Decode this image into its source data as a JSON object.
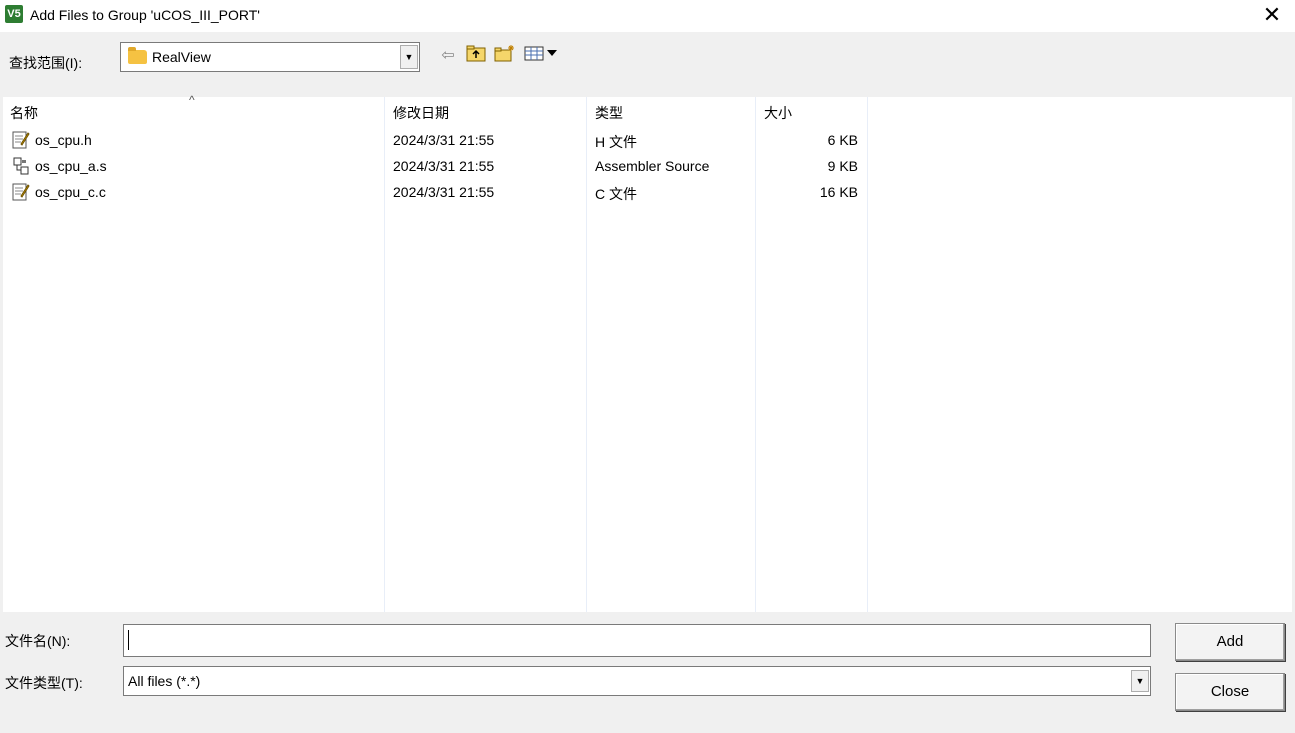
{
  "window": {
    "title": "Add Files to Group 'uCOS_III_PORT'",
    "app_icon_text": "V5"
  },
  "lookin": {
    "label": "查找范围(I):",
    "value": "RealView"
  },
  "toolbar": {
    "icons": [
      "back-icon",
      "up-folder-icon",
      "new-folder-icon",
      "view-menu-icon"
    ]
  },
  "columns": {
    "name": "名称",
    "modified": "修改日期",
    "type": "类型",
    "size": "大小"
  },
  "files": [
    {
      "name": "os_cpu.h",
      "modified": "2024/3/31 21:55",
      "type": "H 文件",
      "size": "6 KB",
      "icon": "text-file-icon"
    },
    {
      "name": "os_cpu_a.s",
      "modified": "2024/3/31 21:55",
      "type": "Assembler Source",
      "size": "9 KB",
      "icon": "assembler-file-icon"
    },
    {
      "name": "os_cpu_c.c",
      "modified": "2024/3/31 21:55",
      "type": "C 文件",
      "size": "16 KB",
      "icon": "text-file-icon"
    }
  ],
  "filename": {
    "label": "文件名(N):",
    "value": ""
  },
  "filetype": {
    "label": "文件类型(T):",
    "value": "All files (*.*)"
  },
  "buttons": {
    "add": "Add",
    "close": "Close"
  }
}
